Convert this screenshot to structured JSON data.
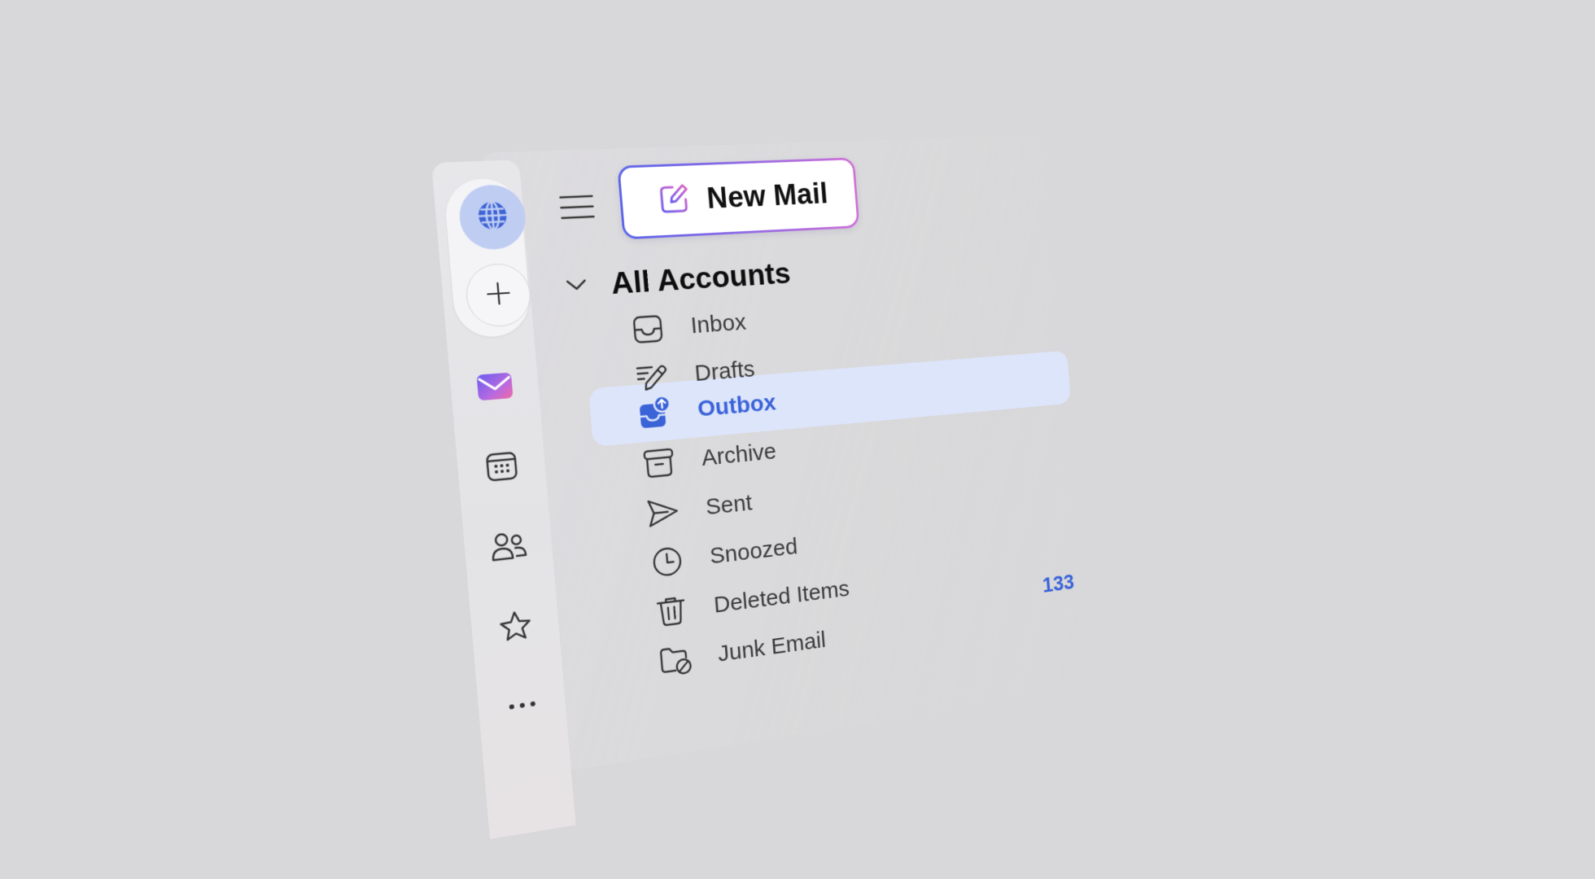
{
  "toolbar": {
    "new_mail_label": "New Mail"
  },
  "account_group": {
    "title": "All Accounts"
  },
  "folders": [
    {
      "label": "Inbox",
      "icon": "inbox-icon"
    },
    {
      "label": "Drafts",
      "icon": "pencil-icon"
    },
    {
      "label": "Outbox",
      "icon": "outbox-icon",
      "selected": true
    },
    {
      "label": "Archive",
      "icon": "archive-icon"
    },
    {
      "label": "Sent",
      "icon": "send-icon"
    },
    {
      "label": "Snoozed",
      "icon": "clock-icon"
    },
    {
      "label": "Deleted Items",
      "icon": "trash-icon"
    },
    {
      "label": "Junk Email",
      "icon": "junk-folder-icon"
    }
  ],
  "unread_count": "133",
  "rail": {
    "items": [
      "globe-icon",
      "add-icon",
      "mail-app-icon",
      "calendar-icon",
      "people-icon",
      "star-icon",
      "more-icon"
    ]
  },
  "colors": {
    "accent": "#3a63d8",
    "selection": "#dde5fb",
    "gradient_start": "#5a64e8",
    "gradient_end": "#d070d6"
  }
}
